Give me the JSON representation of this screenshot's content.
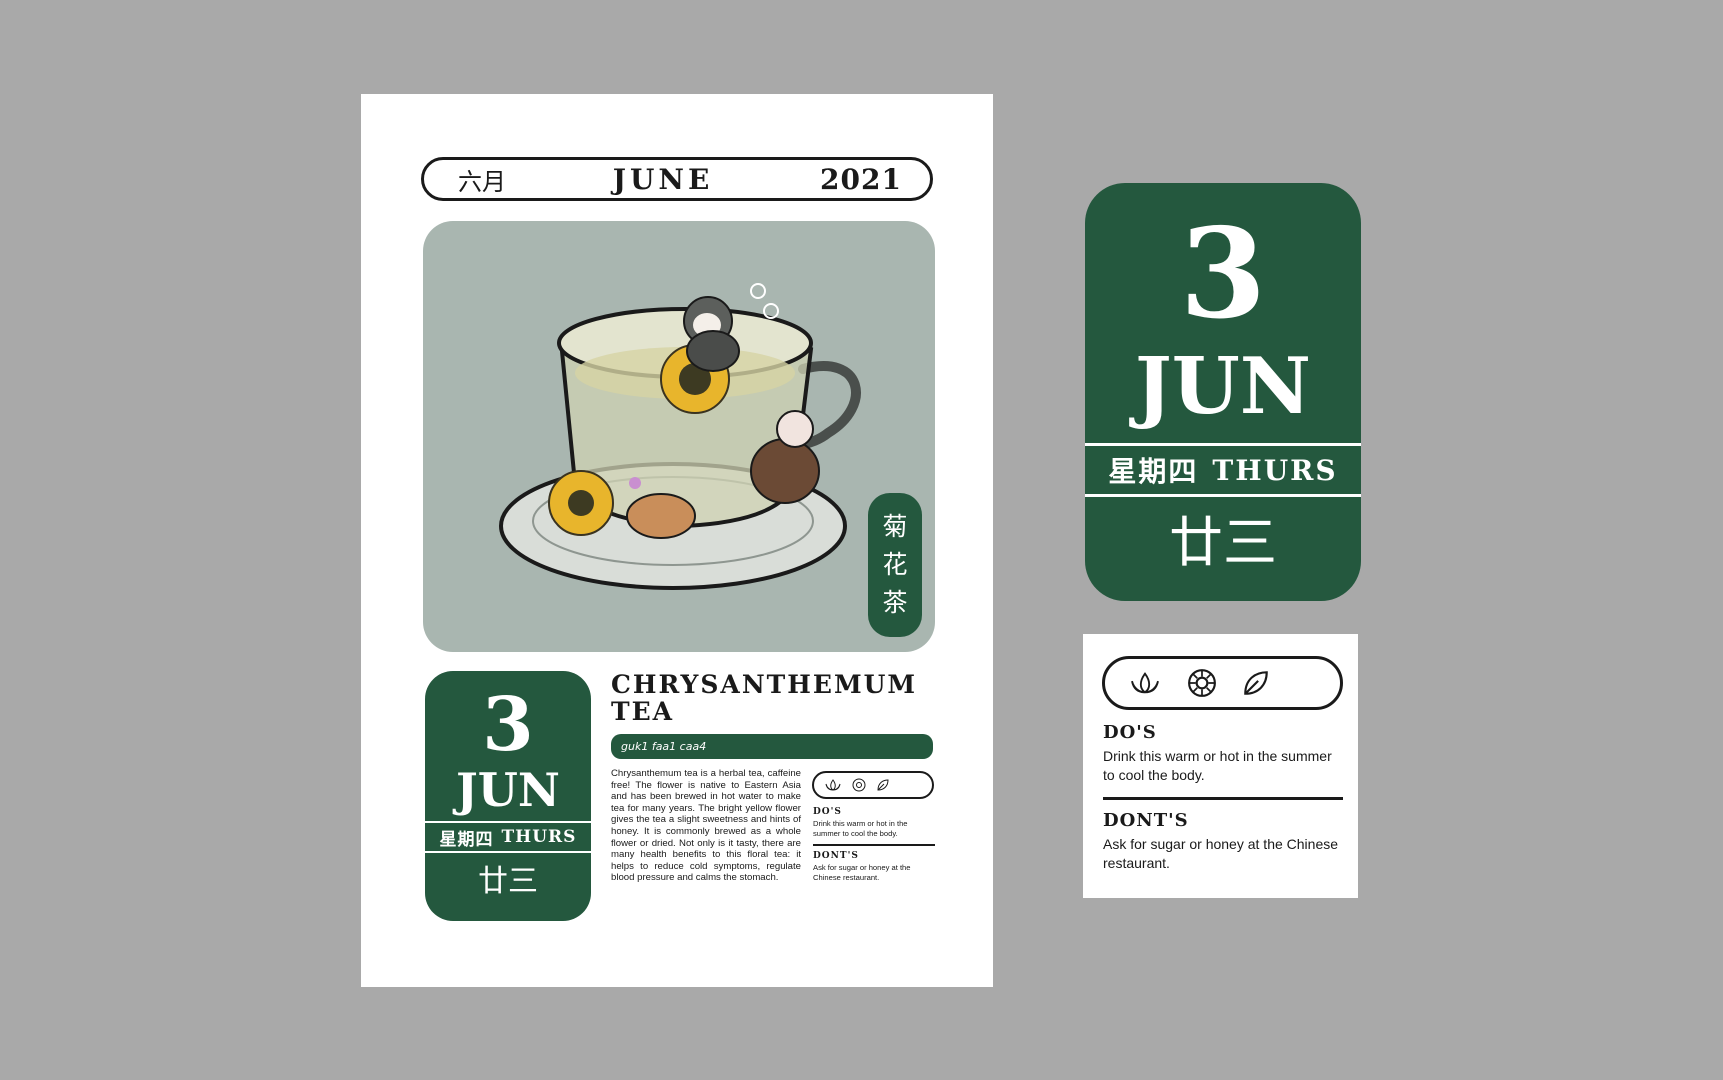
{
  "colors": {
    "background": "#a9a9a9",
    "green": "#24583e",
    "illustration_bg": "#a9b6b0"
  },
  "calendar": {
    "month_cn": "六月",
    "month_en": "JUNE",
    "year": "2021",
    "tea_label_chars": [
      "菊",
      "花",
      "茶"
    ],
    "title_line1": "CHRYSANTHEMUM",
    "title_line2": "TEA",
    "pinyin": "guk1 faa1 caa4",
    "description": "Chrysanthemum tea is a herbal tea, caffeine free! The flower is native to Eastern Asia and has been brewed in hot water to make tea for many years. The bright yellow flower gives the tea a slight sweetness and hints of honey. It is commonly brewed as a whole flower or dried. Not only is it tasty, there are many health benefits to this floral tea: it helps to reduce cold symptoms, regulate blood pressure and calms the stomach."
  },
  "date": {
    "day": "3",
    "month": "JUN",
    "weekday_cn": "星期四",
    "weekday_en": "THURS",
    "lunar": "廿三"
  },
  "icons": [
    "lotus-icon",
    "chrysanthemum-icon",
    "leaf-icon"
  ],
  "advice": {
    "dos_heading": "DO'S",
    "dos_text": "Drink this warm or hot in the summer to cool the body.",
    "donts_heading": "DONT'S",
    "donts_text": "Ask for sugar or honey at the Chinese restaurant."
  }
}
